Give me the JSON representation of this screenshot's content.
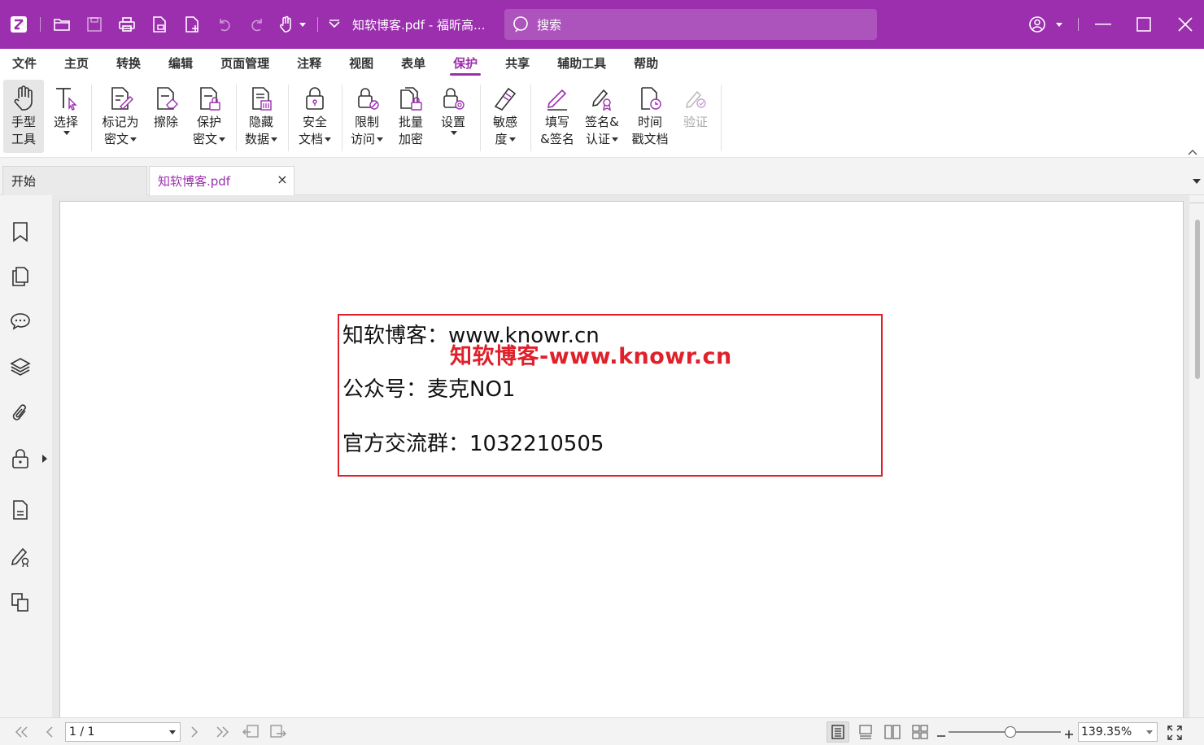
{
  "title_bar": {
    "document_title": "知软博客.pdf - 福昕高...",
    "search_placeholder": "搜索",
    "icons": [
      "app-logo-icon",
      "open-folder-icon",
      "save-icon",
      "print-icon",
      "export-icon",
      "new-file-icon",
      "undo-icon",
      "redo-icon",
      "hand-tool-icon",
      "customize-icon",
      "account-icon",
      "minimize-icon",
      "maximize-icon",
      "close-icon"
    ]
  },
  "menu": {
    "items": [
      "文件",
      "主页",
      "转换",
      "编辑",
      "页面管理",
      "注释",
      "视图",
      "表单",
      "保护",
      "共享",
      "辅助工具",
      "帮助"
    ],
    "active": "保护"
  },
  "ribbon": {
    "buttons": [
      {
        "label": "手型\n工具",
        "icon": "hand-icon"
      },
      {
        "label": "选择",
        "icon": "select-text-icon",
        "dropdown": true
      },
      {
        "label": "标记为\n密文",
        "icon": "mark-redaction-icon",
        "dropdown": true
      },
      {
        "label": "擦除",
        "icon": "erase-icon"
      },
      {
        "label": "保护\n密文",
        "icon": "protect-redaction-icon",
        "dropdown": true
      },
      {
        "label": "隐藏\n数据",
        "icon": "hide-data-icon",
        "dropdown": true
      },
      {
        "label": "安全\n文档",
        "icon": "secure-document-icon",
        "dropdown": true
      },
      {
        "label": "限制\n访问",
        "icon": "restrict-access-icon",
        "dropdown": true
      },
      {
        "label": "批量\n加密",
        "icon": "batch-encrypt-icon"
      },
      {
        "label": "设置",
        "icon": "settings-icon",
        "dropdown": true
      },
      {
        "label": "敏感\n度",
        "icon": "sensitivity-icon",
        "dropdown": true
      },
      {
        "label": "填写\n&签名",
        "icon": "fill-sign-icon"
      },
      {
        "label": "签名&\n认证",
        "icon": "sign-certify-icon",
        "dropdown": true
      },
      {
        "label": "时间\n戳文档",
        "icon": "timestamp-icon"
      },
      {
        "label": "验证",
        "icon": "validate-icon",
        "disabled": true
      }
    ]
  },
  "tabs": {
    "home": "开始",
    "document": "知软博客.pdf"
  },
  "sidebar": {
    "icons": [
      "bookmark-icon",
      "pages-icon",
      "comments-icon",
      "layers-icon",
      "attachments-icon",
      "security-lock-icon",
      "document-info-icon",
      "signature-icon",
      "compare-icon"
    ]
  },
  "document": {
    "lines": [
      "知软博客：www.knowr.cn",
      "公众号：麦克NO1",
      "官方交流群：1032210505"
    ],
    "watermark": "知软博客-www.knowr.cn",
    "box_color": "#e0202a"
  },
  "status_bar": {
    "page_indicator": "1 / 1",
    "zoom": "139.35%",
    "zoom_level": 0.55
  },
  "colors": {
    "accent": "#9b2fae",
    "highlight_red": "#e0202a"
  }
}
